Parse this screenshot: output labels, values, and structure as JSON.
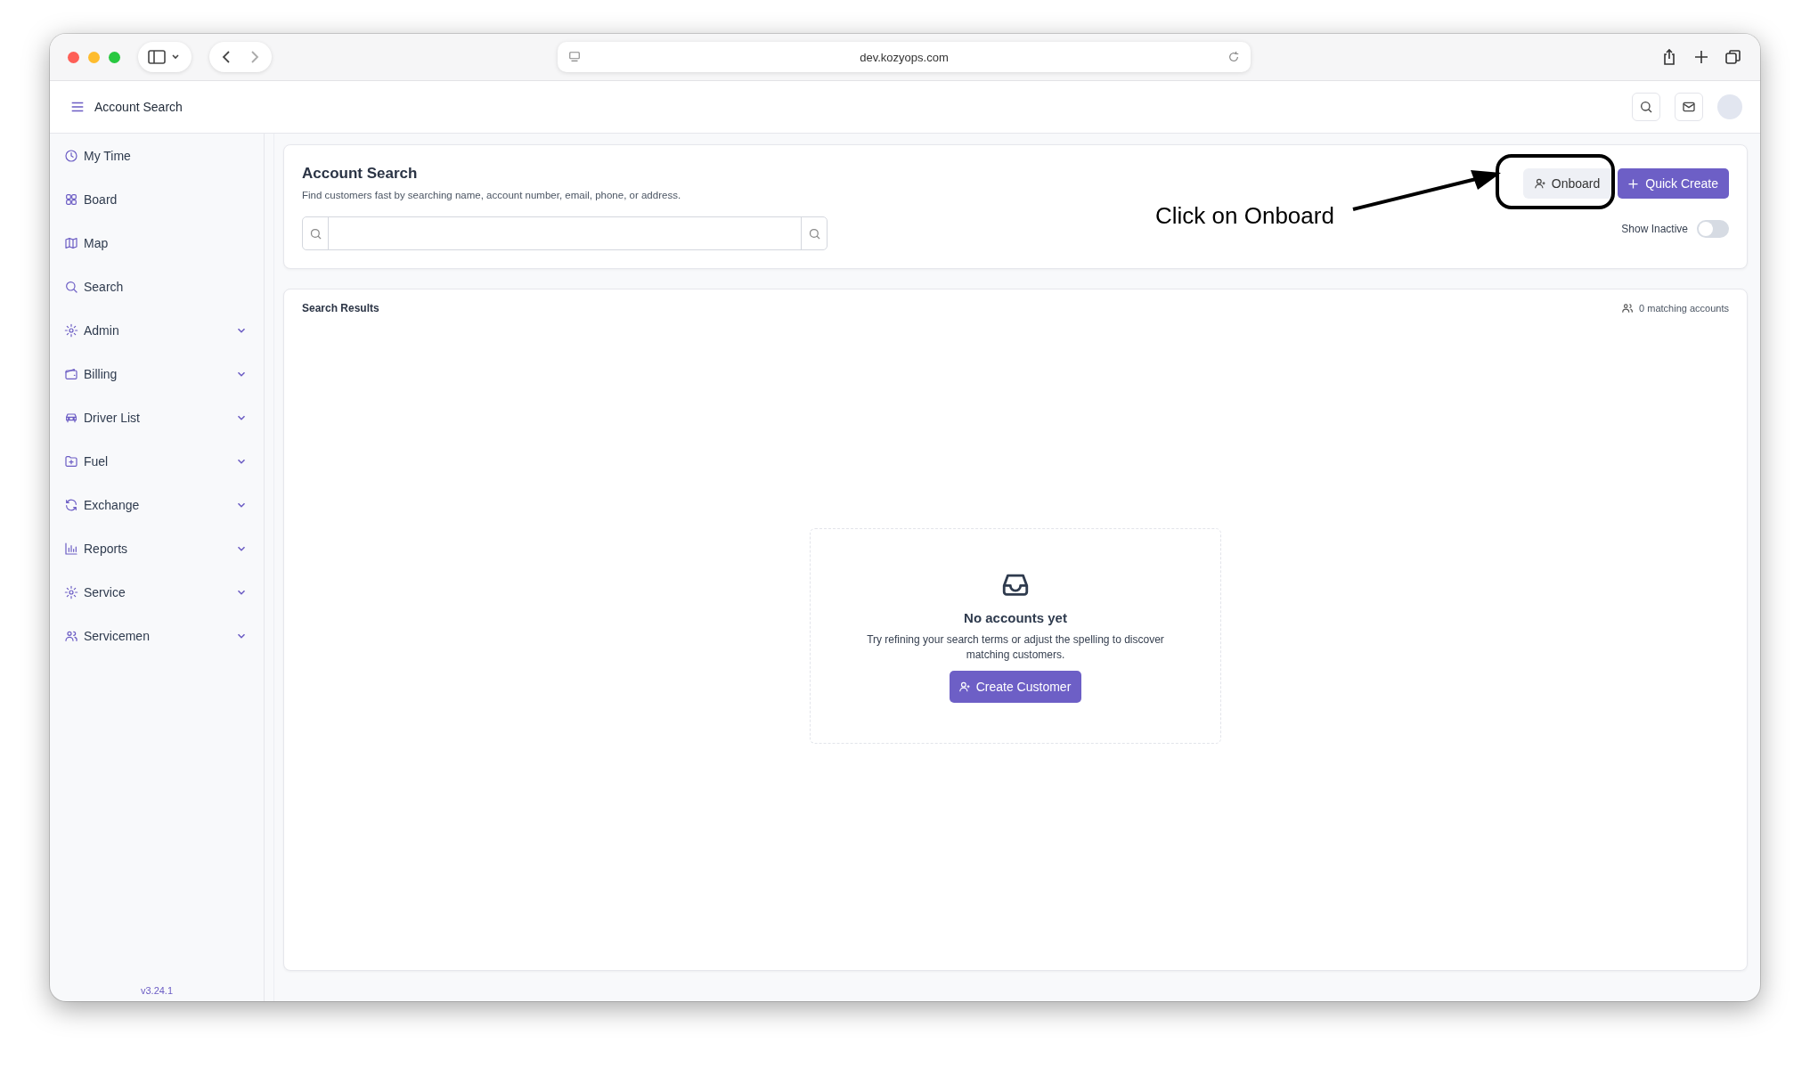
{
  "browser": {
    "url": "dev.kozyops.com"
  },
  "header": {
    "title": "Account Search"
  },
  "sidebar": {
    "items": [
      {
        "label": "My Time",
        "kind": "link"
      },
      {
        "label": "Board",
        "kind": "link"
      },
      {
        "label": "Map",
        "kind": "link"
      },
      {
        "label": "Search",
        "kind": "link"
      },
      {
        "label": "Admin",
        "kind": "group"
      },
      {
        "label": "Billing",
        "kind": "group"
      },
      {
        "label": "Driver List",
        "kind": "group"
      },
      {
        "label": "Fuel",
        "kind": "group"
      },
      {
        "label": "Exchange",
        "kind": "group"
      },
      {
        "label": "Reports",
        "kind": "group"
      },
      {
        "label": "Service",
        "kind": "group"
      },
      {
        "label": "Servicemen",
        "kind": "group"
      }
    ],
    "version": "v3.24.1"
  },
  "search_panel": {
    "title": "Account Search",
    "subtitle": "Find customers fast by searching name, account number, email, phone, or address.",
    "onboard_button": "Onboard",
    "quick_create_button": "Quick Create",
    "show_inactive": {
      "label": "Show Inactive",
      "on": false
    }
  },
  "annotation": {
    "text": "Click on Onboard"
  },
  "results": {
    "title": "Search Results",
    "count": "0 matching accounts",
    "empty": {
      "title": "No accounts yet",
      "message": "Try refining your search terms or adjust the spelling to discover matching customers.",
      "button": "Create Customer"
    }
  }
}
